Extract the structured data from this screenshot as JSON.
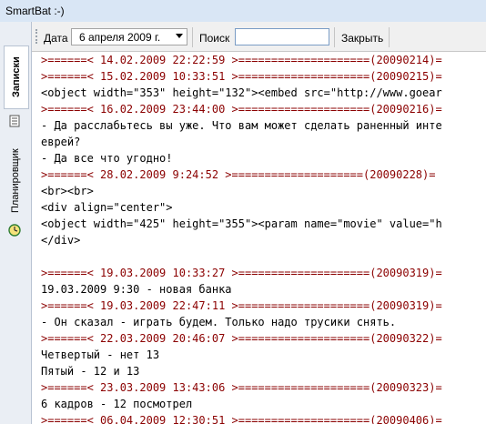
{
  "window": {
    "title": "SmartBat :-)"
  },
  "sidebar": {
    "tabs": [
      {
        "label": "Записки",
        "active": true
      },
      {
        "label": "Планировщик",
        "active": false
      }
    ],
    "icons": [
      "notes-icon",
      "scheduler-icon"
    ]
  },
  "toolbar": {
    "date_label": "Дата",
    "date_value": "6   апреля   2009 г.",
    "search_label": "Поиск",
    "search_value": "",
    "close_label": "Закрыть"
  },
  "colors": {
    "header_text": "#8b0000",
    "body_text": "#000000"
  },
  "lines": [
    {
      "text": ">======< 14.02.2009 22:22:59 >====================(20090214)=",
      "type": "header"
    },
    {
      "text": ">======< 15.02.2009 10:33:51 >====================(20090215)=",
      "type": "header"
    },
    {
      "text": "<object width=\"353\" height=\"132\"><embed src=\"http://www.goear",
      "type": "text"
    },
    {
      "text": ">======< 16.02.2009 23:44:00 >====================(20090216)=",
      "type": "header"
    },
    {
      "text": "- Да расслабьтесь вы уже. Что вам может сделать раненный инте",
      "type": "text"
    },
    {
      "text": "еврей?",
      "type": "text"
    },
    {
      "text": "- Да все что угодно!",
      "type": "text"
    },
    {
      "text": ">======< 28.02.2009 9:24:52 >====================(20090228)=",
      "type": "header"
    },
    {
      "text": "<br><br>",
      "type": "text"
    },
    {
      "text": "<div align=\"center\">",
      "type": "text"
    },
    {
      "text": "<object width=\"425\" height=\"355\"><param name=\"movie\" value=\"h",
      "type": "text"
    },
    {
      "text": "</div>",
      "type": "text"
    },
    {
      "text": "",
      "type": "text"
    },
    {
      "text": ">======< 19.03.2009 10:33:27 >====================(20090319)=",
      "type": "header"
    },
    {
      "text": "19.03.2009 9:30 - новая банка",
      "type": "text"
    },
    {
      "text": ">======< 19.03.2009 22:47:11 >====================(20090319)=",
      "type": "header"
    },
    {
      "text": "- Он сказал - играть будем. Только надо трусики снять.",
      "type": "text"
    },
    {
      "text": ">======< 22.03.2009 20:46:07 >====================(20090322)=",
      "type": "header"
    },
    {
      "text": "Четвертый - нет 13",
      "type": "text"
    },
    {
      "text": "Пятый - 12 и 13",
      "type": "text"
    },
    {
      "text": ">======< 23.03.2009 13:43:06 >====================(20090323)=",
      "type": "header"
    },
    {
      "text": "6 кадров - 12 посмотрел",
      "type": "text"
    },
    {
      "text": ">======< 06.04.2009 12:30:51 >====================(20090406)=",
      "type": "header"
    }
  ]
}
